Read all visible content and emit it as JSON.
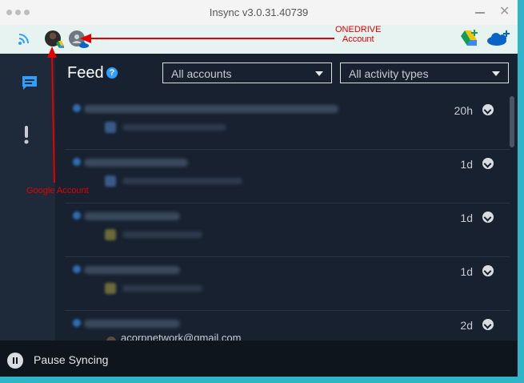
{
  "window": {
    "title": "Insync v3.0.31.40739"
  },
  "account_bar": {
    "icons": [
      "wifi-icon",
      "google-account-avatar",
      "onedrive-account-avatar",
      "google-drive-icon",
      "onedrive-icon"
    ]
  },
  "sidebar": {
    "icons": [
      "feed-icon",
      "alert-icon"
    ]
  },
  "main": {
    "title": "Feed",
    "help": "?",
    "accounts_select": "All accounts",
    "activity_select": "All activity types"
  },
  "feed": {
    "items": [
      {
        "time": "20h"
      },
      {
        "time": "1d"
      },
      {
        "time": "1d"
      },
      {
        "time": "1d"
      },
      {
        "time": "2d"
      }
    ],
    "partial_email": "acorpnetwork@gmail.com"
  },
  "bottom": {
    "pause_label": "Pause Syncing"
  },
  "annotations": {
    "onedrive_line1": "ONEDRIVE",
    "onedrive_line2": "Account",
    "google": "Google Account"
  },
  "colors": {
    "annotation": "#e30000",
    "background": "#17212f",
    "accent": "#2f9fff"
  }
}
